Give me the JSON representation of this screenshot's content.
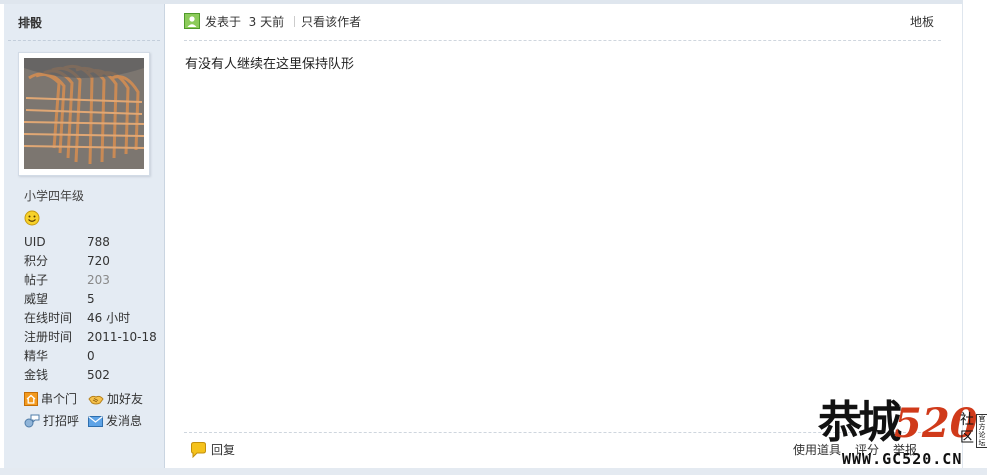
{
  "author": {
    "name": "排骰"
  },
  "profile": {
    "level": "小学四年级",
    "stats": [
      {
        "label": "UID",
        "value": "788"
      },
      {
        "label": "积分",
        "value": "720"
      },
      {
        "label": "帖子",
        "value": "203"
      },
      {
        "label": "威望",
        "value": "5"
      },
      {
        "label": "在线时间",
        "value": "46 小时"
      },
      {
        "label": "注册时间",
        "value": "2011-10-18"
      },
      {
        "label": "精华",
        "value": "0"
      },
      {
        "label": "金钱",
        "value": "502"
      }
    ],
    "actions": {
      "visit": "串个门",
      "add_friend": "加好友",
      "greet": "打招呼",
      "message": "发消息"
    }
  },
  "post": {
    "posted_label": "发表于",
    "posted_time": "3 天前",
    "only_author": "只看该作者",
    "floor": "地板",
    "content": "有没有人继续在这里保持队形",
    "reply": "回复",
    "footer_links": [
      "使用道具",
      "评分",
      "举报"
    ]
  },
  "watermark": {
    "brand": "恭城",
    "number": "520",
    "she": "社",
    "qu": "区",
    "side": "官方论坛",
    "url": "WWW.GC520.CN"
  }
}
